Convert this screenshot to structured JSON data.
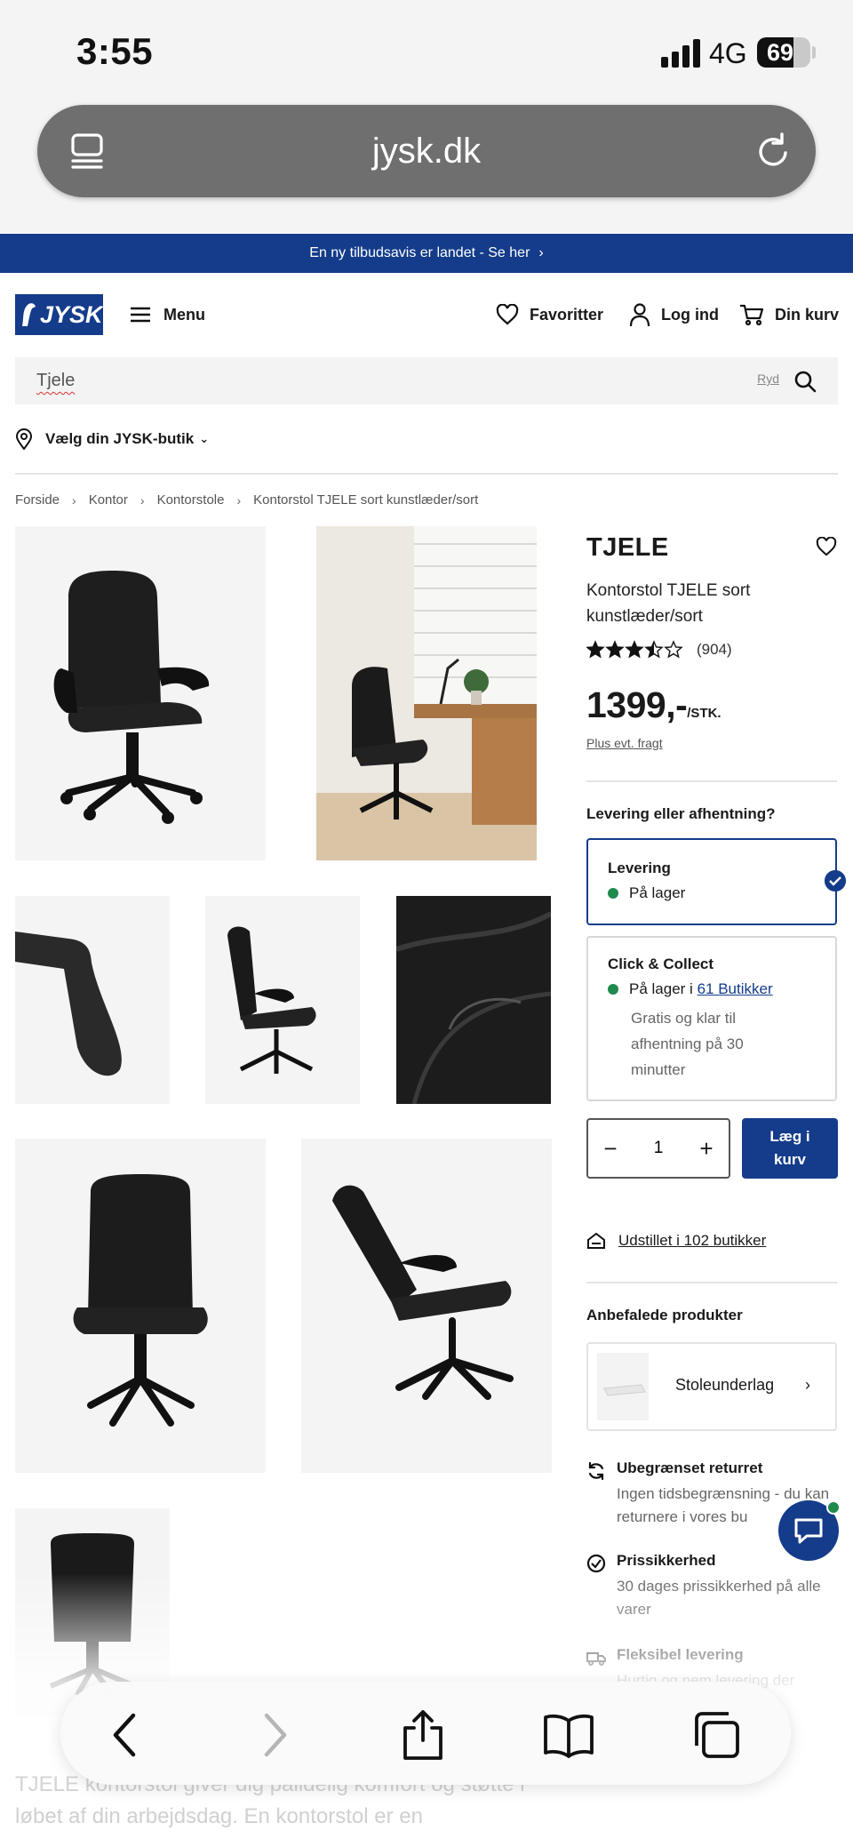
{
  "status_bar": {
    "time": "3:55",
    "network": "4G",
    "battery": "69",
    "battery_level": 0.69
  },
  "browser": {
    "url": "jysk.dk"
  },
  "promo": {
    "text": "En ny tilbudsavis er landet - Se her"
  },
  "header": {
    "logo_text": "JYSK",
    "menu_label": "Menu",
    "favorites_label": "Favoritter",
    "login_label": "Log ind",
    "cart_label": "Din kurv"
  },
  "search": {
    "value": "Tjele",
    "clear_label": "Ryd"
  },
  "store_picker": {
    "label": "Vælg din JYSK-butik"
  },
  "breadcrumb": [
    "Forside",
    "Kontor",
    "Kontorstole",
    "Kontorstol TJELE sort kunstlæder/sort"
  ],
  "product": {
    "title": "TJELE",
    "subtitle": "Kontorstol TJELE sort kunstlæder/sort",
    "rating": 3.5,
    "rating_max": 5,
    "reviews": "(904)",
    "price": "1399,-",
    "price_unit": "/STK.",
    "shipping_link": "Plus evt. fragt"
  },
  "delivery": {
    "heading": "Levering eller afhentning?",
    "options": [
      {
        "title": "Levering",
        "status": "På lager"
      },
      {
        "title": "Click & Collect",
        "status_prefix": "På lager i",
        "status_link": "61 Butikker",
        "note": "Gratis og klar til afhentning på 30 minutter"
      }
    ]
  },
  "quantity": {
    "minus": "−",
    "value": "1",
    "plus": "+"
  },
  "add_to_cart": {
    "line1": "Læg i",
    "line2": "kurv"
  },
  "displayed_in": "Udstillet i 102 butikker",
  "recommended": {
    "heading": "Anbefalede produkter",
    "item": "Stoleunderlag"
  },
  "usps": [
    {
      "title": "Ubegrænset returret",
      "text": "Ingen tidsbegrænsning - du kan returnere i vores bu"
    },
    {
      "title": "Prissikkerhed",
      "text": "30 dages prissikkerhed på alle varer"
    },
    {
      "title": "Fleksibel levering",
      "text": "Hurtig og nem levering der"
    }
  ],
  "description": "TJELE kontorstol giver dig pålidelig komfort og støtte i løbet af din arbejdsdag. En kontorstol er en",
  "colors": {
    "brand_blue": "#143c8a",
    "stock_green": "#1f8a4c",
    "tile_bg": "#f4f4f4"
  }
}
